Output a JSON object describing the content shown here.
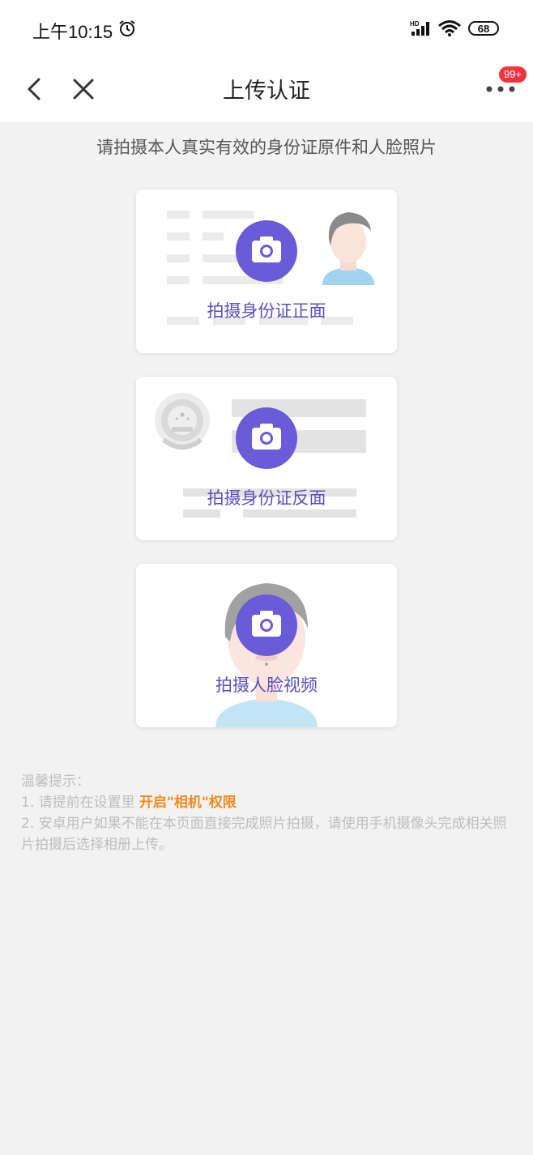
{
  "status": {
    "time": "上午10:15",
    "battery": "68",
    "network": "HD"
  },
  "nav": {
    "title": "上传认证",
    "badge": "99+"
  },
  "subtitle": "请拍摄本人真实有效的身份证原件和人脸照片",
  "cards": [
    {
      "label": "拍摄身份证正面",
      "icon": "camera-icon"
    },
    {
      "label": "拍摄身份证反面",
      "icon": "camera-icon"
    },
    {
      "label": "拍摄人脸视频",
      "icon": "camera-icon"
    }
  ],
  "tips": {
    "title": "温馨提示：",
    "line1_prefix": "1. 请提前在设置里 ",
    "line1_highlight": "开启\"相机\"权限",
    "line2": "2. 安卓用户如果不能在本页面直接完成照片拍摄，请使用手机摄像头完成相关照片拍摄后选择相册上传。"
  },
  "colors": {
    "accent": "#6a5bd8",
    "highlight": "#f48a1a",
    "badge": "#f2333f",
    "background": "#f2f2f2"
  }
}
